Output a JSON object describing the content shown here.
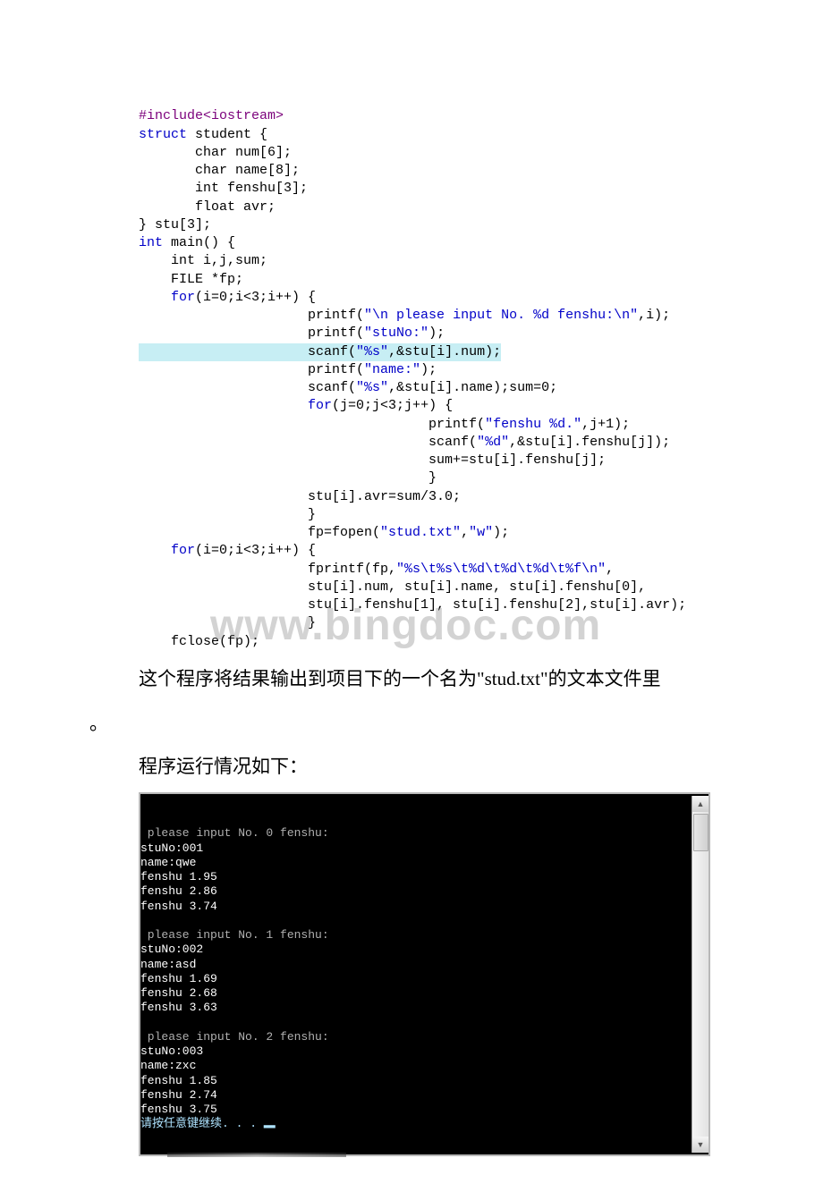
{
  "code": {
    "l1a": "#include",
    "l1b": "<iostream>",
    "l2a": "struct",
    "l2b": " student {",
    "l3": "       char num[6];",
    "l4": "       char name[8];",
    "l5": "       int fenshu[3];",
    "l6": "       float avr;",
    "l7": "} stu[3];",
    "l8a": "int",
    "l8b": " main() {",
    "l9": "    int i,j,sum;",
    "l10": "    FILE *fp;",
    "l11a": "    for",
    "l11b": "(i=0;i<3;i++) {",
    "l12a": "                     printf(",
    "l12b": "\"\\n please input No. %d fenshu:\\n\"",
    "l12c": ",i);",
    "l13a": "                     printf(",
    "l13b": "\"stuNo:\"",
    "l13c": ");",
    "l14a": "                     scanf(",
    "l14b": "\"%s\"",
    "l14c": ",&stu[i].num);",
    "l15a": "                     printf(",
    "l15b": "\"name:\"",
    "l15c": ");",
    "l16a": "                     scanf(",
    "l16b": "\"%s\"",
    "l16c": ",&stu[i].name);sum=0;",
    "l17a": "                     for",
    "l17b": "(j=0;j<3;j++) {",
    "l18a": "                                    printf(",
    "l18b": "\"fenshu %d.\"",
    "l18c": ",j+1);",
    "l19a": "                                    scanf(",
    "l19b": "\"%d\"",
    "l19c": ",&stu[i].fenshu[j]);",
    "l20": "                                    sum+=stu[i].fenshu[j];",
    "l21": "                                    }",
    "l22": "                     stu[i].avr=sum/3.0;",
    "l23": "                     }",
    "l24a": "                     fp=fopen(",
    "l24b": "\"stud.txt\"",
    "l24c": ",",
    "l24d": "\"w\"",
    "l24e": ");",
    "l25a": "    for",
    "l25b": "(i=0;i<3;i++) {",
    "l26a": "                     fprintf(fp,",
    "l26b": "\"%s\\t%s\\t%d\\t%d\\t%d\\t%f\\n\"",
    "l26c": ",",
    "l27": "                     stu[i].num, stu[i].name, stu[i].fenshu[0],",
    "l28": "                     stu[i].fenshu[1], stu[i].fenshu[2],stu[i].avr);",
    "l29": "                     }",
    "l30": "    fclose(fp);"
  },
  "watermark": "www.bingdoc.com",
  "para1": "这个程序将结果输出到项目下的一个名为\"stud.txt\"的文本文件里",
  "period": "。",
  "para2": "程序运行情况如下：",
  "console": {
    "blank": "",
    "r1": " please input No. 0 fenshu:",
    "r2": "stuNo:001",
    "r3": "name:qwe",
    "r4": "fenshu 1.95",
    "r5": "fenshu 2.86",
    "r6": "fenshu 3.74",
    "r7": " please input No. 1 fenshu:",
    "r8": "stuNo:002",
    "r9": "name:asd",
    "r10": "fenshu 1.69",
    "r11": "fenshu 2.68",
    "r12": "fenshu 3.63",
    "r13": " please input No. 2 fenshu:",
    "r14": "stuNo:003",
    "r15": "name:zxc",
    "r16": "fenshu 1.85",
    "r17": "fenshu 2.74",
    "r18": "fenshu 3.75",
    "r19": "请按任意键继续. . . ▂"
  },
  "scroll": {
    "up": "▲",
    "down": "▼"
  }
}
